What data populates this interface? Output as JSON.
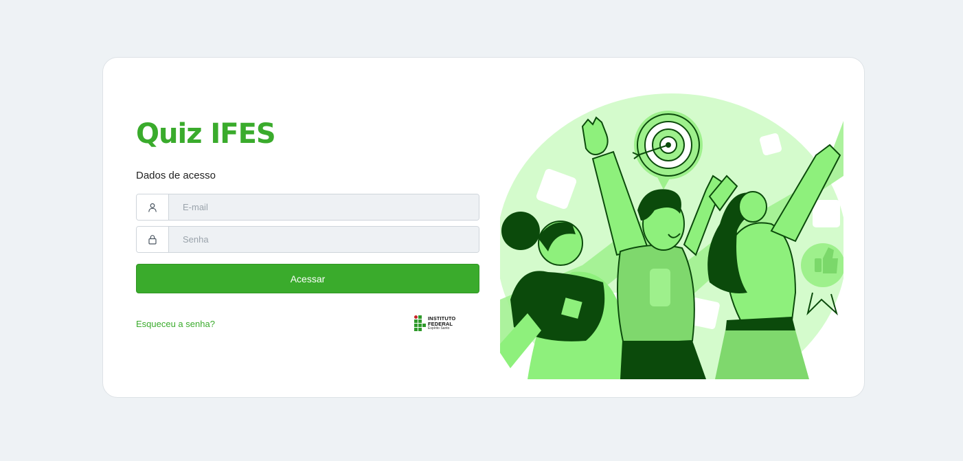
{
  "app": {
    "title": "Quiz IFES",
    "subtitle": "Dados de acesso"
  },
  "form": {
    "email_placeholder": "E-mail",
    "email_value": "",
    "password_placeholder": "Senha",
    "password_value": "",
    "submit_label": "Acessar",
    "forgot_label": "Esqueceu a senha?"
  },
  "logo": {
    "name": "INSTITUTO FEDERAL",
    "campus": "Espírito Santo"
  },
  "icons": {
    "email": "user-icon",
    "password": "lock-icon"
  },
  "colors": {
    "accent": "#3aab2c",
    "background": "#eef2f5",
    "input_bg": "#eef1f4",
    "illustration_dark": "#0b4a0b",
    "illustration_light": "#8ef07c"
  }
}
